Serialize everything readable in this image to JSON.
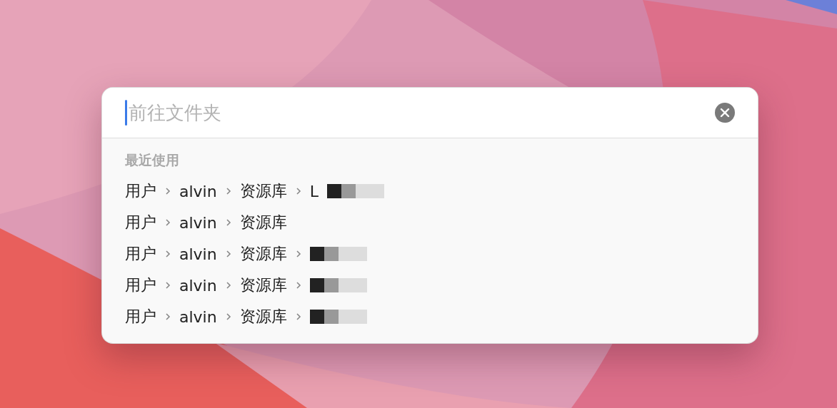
{
  "search": {
    "placeholder": "前往文件夹"
  },
  "recent": {
    "heading": "最近使用",
    "rows": [
      {
        "segments": [
          "用户",
          "alvin",
          "资源库",
          "L"
        ],
        "redacted": true
      },
      {
        "segments": [
          "用户",
          "alvin",
          "资源库"
        ],
        "redacted": false
      },
      {
        "segments": [
          "用户",
          "alvin",
          "资源库"
        ],
        "redacted": true
      },
      {
        "segments": [
          "用户",
          "alvin",
          "资源库"
        ],
        "redacted": true
      },
      {
        "segments": [
          "用户",
          "alvin",
          "资源库"
        ],
        "redacted": true
      }
    ]
  }
}
